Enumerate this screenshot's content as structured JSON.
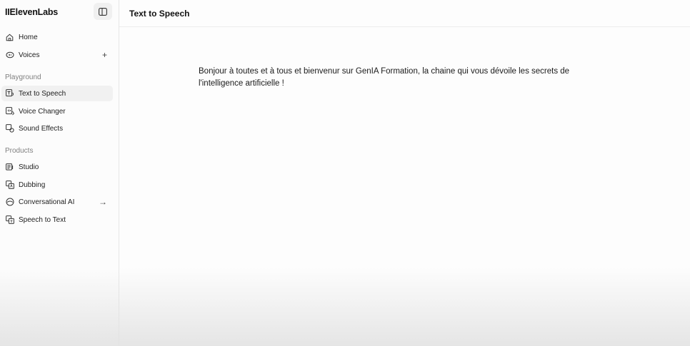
{
  "brand": {
    "logo": "IIElevenLabs"
  },
  "sidebar": {
    "top_items": [
      {
        "label": "Home",
        "icon": "home-icon"
      },
      {
        "label": "Voices",
        "icon": "voices-icon",
        "trailing": "+"
      }
    ],
    "playground_label": "Playground",
    "playground_items": [
      {
        "label": "Text to Speech",
        "icon": "text-to-speech-icon",
        "active": true
      },
      {
        "label": "Voice Changer",
        "icon": "voice-changer-icon"
      },
      {
        "label": "Sound Effects",
        "icon": "sound-effects-icon"
      }
    ],
    "products_label": "Products",
    "product_items": [
      {
        "label": "Studio",
        "icon": "studio-icon"
      },
      {
        "label": "Dubbing",
        "icon": "dubbing-icon"
      },
      {
        "label": "Conversational AI",
        "icon": "conversational-ai-icon",
        "trailing": "→"
      },
      {
        "label": "Speech to Text",
        "icon": "speech-to-text-icon"
      }
    ]
  },
  "header": {
    "title": "Text to Speech"
  },
  "editor": {
    "text": "Bonjour à toutes et à tous et bienvenur sur GenIA Formation, la chaine qui vous dévoile les secrets de l'intelligence artificielle !"
  }
}
